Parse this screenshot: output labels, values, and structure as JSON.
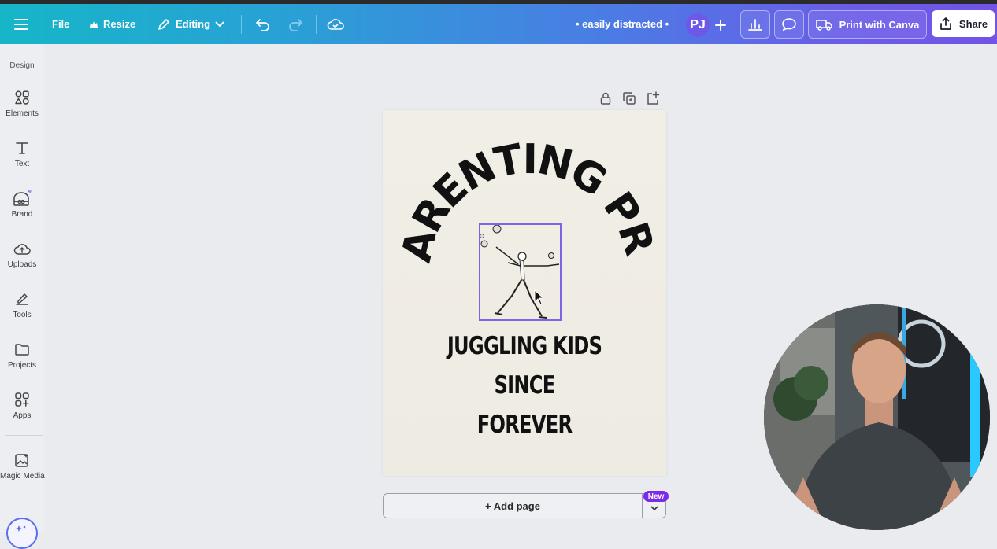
{
  "topbar": {
    "menu_icon": "hamburger-icon",
    "file_label": "File",
    "resize_label": "Resize",
    "editing_label": "Editing",
    "doc_title": "• easily distracted •",
    "avatar_initials": "PJ",
    "print_label": "Print with Canva",
    "share_label": "Share"
  },
  "sidebar": {
    "section_label": "Design",
    "items": [
      {
        "label": "Elements",
        "icon": "elements-icon"
      },
      {
        "label": "Text",
        "icon": "text-icon"
      },
      {
        "label": "Brand",
        "icon": "brand-icon"
      },
      {
        "label": "Uploads",
        "icon": "uploads-icon"
      },
      {
        "label": "Tools",
        "icon": "tools-icon"
      },
      {
        "label": "Projects",
        "icon": "projects-icon"
      },
      {
        "label": "Apps",
        "icon": "apps-icon"
      },
      {
        "label": "Magic Media",
        "icon": "magic-media-icon"
      }
    ]
  },
  "canvas": {
    "headline": "PARENTING PRO",
    "tagline_line1": "JUGGLING KIDS SINCE",
    "tagline_line2": "FOREVER"
  },
  "footer": {
    "add_page_label": "+ Add page",
    "new_badge": "New"
  },
  "colors": {
    "gradient_start": "#16b6c8",
    "gradient_end": "#7254e6",
    "selection": "#7d63e6",
    "badge": "#7d2ae8"
  }
}
